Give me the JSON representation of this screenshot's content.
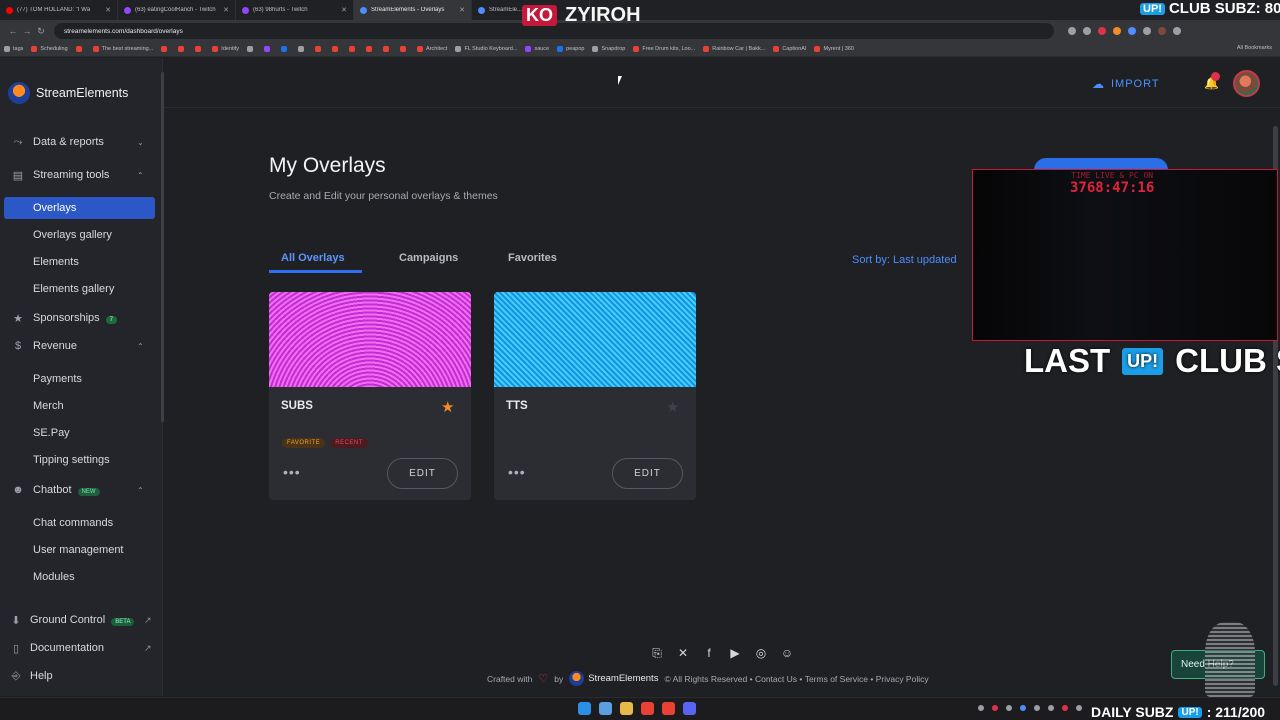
{
  "browser": {
    "tabs": [
      {
        "title": "(77) TOM HOLLAND: \"I Wa",
        "icon_color": "#ff0000",
        "active": false
      },
      {
        "title": "(63) eatingCoolRanch - Twitch",
        "icon_color": "#9146ff",
        "active": false
      },
      {
        "title": "(63) 98hurts - Twitch",
        "icon_color": "#9146ff",
        "active": false
      },
      {
        "title": "StreamElements - Overlays",
        "icon_color": "#4d8dff",
        "active": true
      },
      {
        "title": "StreamEle...",
        "icon_color": "#4d8dff",
        "active": false
      }
    ],
    "url": "streamelements.com/dashboard/overlays",
    "bookmarks": [
      "tags",
      "Scheduling",
      "",
      "The best streaming...",
      "",
      "",
      "",
      "Identify",
      "",
      "",
      "",
      "",
      "",
      "",
      "",
      "",
      "",
      "",
      "Architect",
      "FL Studio Keyboard...",
      "sauce",
      "peapop",
      "Snapdrop",
      "Free Drum kits, Loo...",
      "Rainbow Car | Bakk...",
      "CaptionAI",
      "Myrent | 360"
    ],
    "all_bookmarks": "All Bookmarks"
  },
  "app": {
    "brand": "StreamElements",
    "import_label": "IMPORT",
    "notification_count": "1"
  },
  "sidebar": {
    "items": [
      {
        "kind": "section",
        "label": "Data & reports",
        "icon": "chart-line-icon",
        "glyph": "⤳",
        "chevron": "⌄"
      },
      {
        "kind": "section",
        "label": "Streaming tools",
        "icon": "streaming-tools-icon",
        "glyph": "▤",
        "chevron": "⌃"
      },
      {
        "kind": "sub",
        "label": "Overlays",
        "active": true
      },
      {
        "kind": "sub",
        "label": "Overlays gallery"
      },
      {
        "kind": "sub",
        "label": "Elements"
      },
      {
        "kind": "sub",
        "label": "Elements gallery"
      },
      {
        "kind": "section",
        "label": "Sponsorships",
        "icon": "star-icon",
        "glyph": "★",
        "badge": "7"
      },
      {
        "kind": "section",
        "label": "Revenue",
        "icon": "dollar-icon",
        "glyph": "$",
        "chevron": "⌃"
      },
      {
        "kind": "sub",
        "label": "Payments"
      },
      {
        "kind": "sub",
        "label": "Merch"
      },
      {
        "kind": "sub",
        "label": "SE.Pay"
      },
      {
        "kind": "sub",
        "label": "Tipping settings"
      },
      {
        "kind": "section",
        "label": "Chatbot",
        "icon": "chatbot-icon",
        "glyph": "☻",
        "badge": "NEW",
        "chevron": "⌃"
      },
      {
        "kind": "sub",
        "label": "Chat commands"
      },
      {
        "kind": "sub",
        "label": "User management"
      },
      {
        "kind": "sub",
        "label": "Modules"
      }
    ],
    "bottom": [
      {
        "label": "Ground Control",
        "icon": "ground-control-icon",
        "glyph": "⬇",
        "badge": "BETA"
      },
      {
        "label": "Documentation",
        "icon": "documentation-icon",
        "glyph": "▯"
      },
      {
        "label": "Help",
        "icon": "help-icon",
        "glyph": "⎆"
      }
    ]
  },
  "main": {
    "title": "My Overlays",
    "subtitle": "Create and Edit your personal overlays & themes",
    "tabs": [
      "All Overlays",
      "Campaigns",
      "Favorites"
    ],
    "active_tab": "All Overlays",
    "sort_label": "Sort by: Last updated",
    "overlays": [
      {
        "name": "SUBS",
        "favorite": true,
        "tags": [
          "FAVORITE",
          "RECENT"
        ],
        "edit_label": "EDIT",
        "more": "•••"
      },
      {
        "name": "TTS",
        "favorite": false,
        "tags": [],
        "edit_label": "EDIT",
        "more": "•••"
      }
    ]
  },
  "footer": {
    "social": [
      {
        "icon": "twitch-icon",
        "glyph": "⎘"
      },
      {
        "icon": "x-icon",
        "glyph": "✕"
      },
      {
        "icon": "facebook-icon",
        "glyph": "f"
      },
      {
        "icon": "youtube-icon",
        "glyph": "▶"
      },
      {
        "icon": "instagram-icon",
        "glyph": "◎"
      },
      {
        "icon": "discord-icon",
        "glyph": "☺"
      }
    ],
    "crafted": "Crafted with",
    "by": "by",
    "brand": "StreamElements",
    "rights": "© All Rights Reserved",
    "links": [
      "Contact Us",
      "Terms of Service",
      "Privacy Policy"
    ],
    "help_text": "Need Help?"
  },
  "stream_overlay": {
    "top_name": "ZYIROH",
    "top_badge": "KO",
    "club_top": "CLUB SUBZ: 80",
    "timer_label": "TIME LIVE & PC ON",
    "timer_value": "3768:47:16",
    "last_left": "LAST",
    "last_right": "CLUB S",
    "upi": "UP!",
    "daily_label": "DAILY SUBZ",
    "daily_value": ": 211/200"
  },
  "colors": {
    "accent": "#2f6ef2",
    "link": "#4d8dff",
    "favorite_star": "#f28c28"
  }
}
